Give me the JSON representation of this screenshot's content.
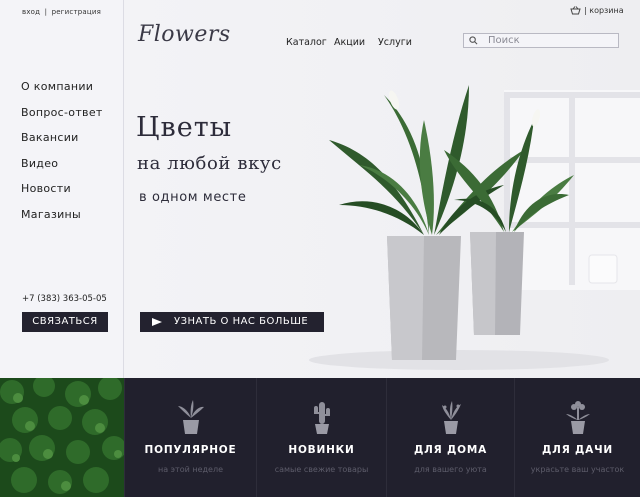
{
  "auth": {
    "login": "вход",
    "separator": "|",
    "register": "регистрация"
  },
  "logo": "Flowers",
  "header": {
    "menu": [
      "Каталог",
      "Акции",
      "Услуги"
    ],
    "search_placeholder": "Поиск",
    "cart_label": "| корзина"
  },
  "sidebar": {
    "items": [
      "О компании",
      "Вопрос-ответ",
      "Вакансии",
      "Видео",
      "Новости",
      "Магазины"
    ],
    "phone": "+7 (383) 363-05-05",
    "contact_button": "СВЯЗАТЬСЯ"
  },
  "hero": {
    "title_line1": "Цветы",
    "title_line2": "на любой вкус",
    "title_line3": "в одном месте",
    "cta_label": "УЗНАТЬ О НАС БОЛЬШЕ"
  },
  "categories": [
    {
      "title": "ПОПУЛЯРНОЕ",
      "subtitle": "на этой неделе",
      "icon": "potted-plant-icon"
    },
    {
      "title": "НОВИНКИ",
      "subtitle": "самые свежие товары",
      "icon": "cactus-icon"
    },
    {
      "title": "ДЛЯ ДОМА",
      "subtitle": "для вашего уюта",
      "icon": "house-plant-icon"
    },
    {
      "title": "ДЛЯ ДАЧИ",
      "subtitle": "украсьте ваш участок",
      "icon": "flower-pot-icon"
    }
  ],
  "colors": {
    "dark": "#23222f",
    "background": "#f2f2f6",
    "muted_text": "#5d5c6a"
  }
}
